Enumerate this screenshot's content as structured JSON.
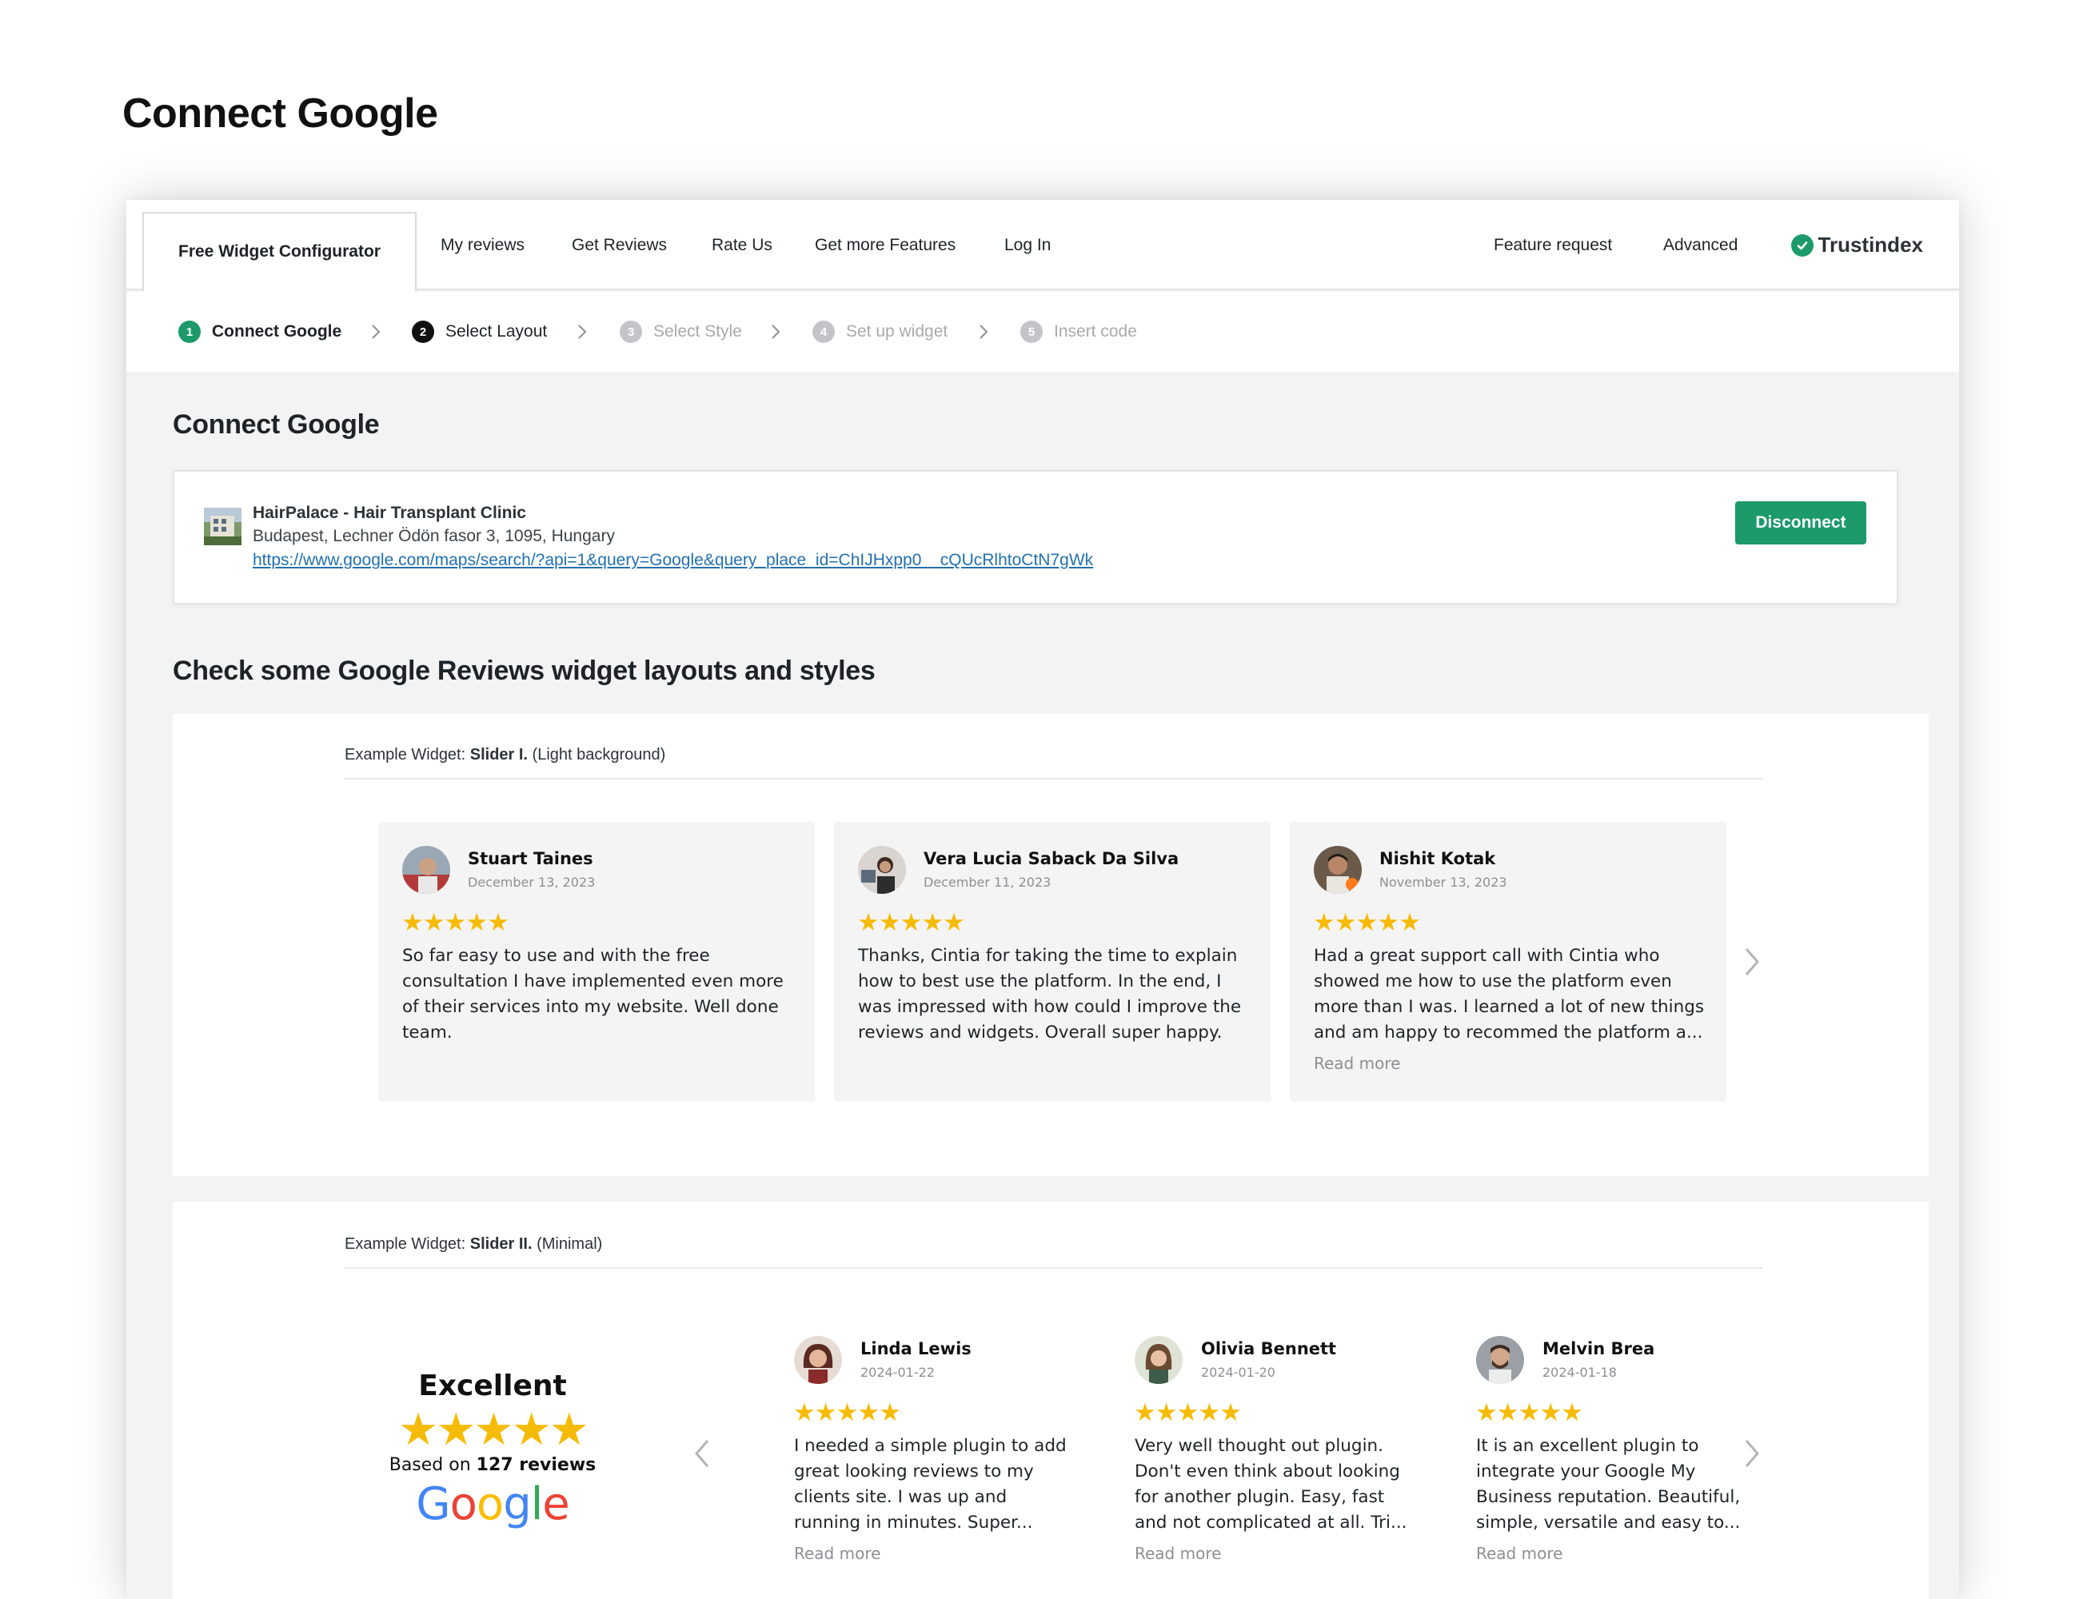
{
  "page_heading": "Connect Google",
  "nav": {
    "active_tab": "Free Widget Configurator",
    "tabs": [
      "My reviews",
      "Get Reviews",
      "Rate Us",
      "Get more Features",
      "Log In"
    ],
    "right_links": [
      "Feature request",
      "Advanced"
    ],
    "brand": "Trustindex"
  },
  "steps": [
    {
      "num": "1",
      "label": "Connect Google",
      "state": "done"
    },
    {
      "num": "2",
      "label": "Select Layout",
      "state": "current"
    },
    {
      "num": "3",
      "label": "Select Style",
      "state": "pending"
    },
    {
      "num": "4",
      "label": "Set up widget",
      "state": "pending"
    },
    {
      "num": "5",
      "label": "Insert code",
      "state": "pending"
    }
  ],
  "connect_section": {
    "title": "Connect Google",
    "place_name": "HairPalace - Hair Transplant Clinic",
    "place_address": "Budapest, Lechner Ödön fasor 3, 1095, Hungary",
    "place_link": "https://www.google.com/maps/search/?api=1&query=Google&query_place_id=ChIJHxpp0__cQUcRlhtoCtN7gWk",
    "disconnect_label": "Disconnect"
  },
  "examples_title": "Check some Google Reviews widget layouts and styles",
  "widget1": {
    "prefix": "Example Widget: ",
    "name": "Slider I.",
    "suffix": " (Light background)",
    "reviews": [
      {
        "name": "Stuart Taines",
        "date": "December 13, 2023",
        "stars": "★★★★★",
        "text": "So far easy to use and with the free consultation I have implemented even more of their services into my website. Well done team."
      },
      {
        "name": "Vera Lucia Saback Da Silva",
        "date": "December 11, 2023",
        "stars": "★★★★★",
        "text": "Thanks, Cintia for taking the time to explain how to best use the platform. In the end, I was impressed with how could I improve the reviews and widgets. Overall super happy."
      },
      {
        "name": "Nishit Kotak",
        "date": "November 13, 2023",
        "stars": "★★★★★",
        "text": "Had a great support call with Cintia who showed me how to use the platform even more than I was. I learned a lot of new things and am happy to recommed the platform a...",
        "read_more": "Read more"
      }
    ]
  },
  "widget2": {
    "prefix": "Example Widget: ",
    "name": "Slider II.",
    "suffix": " (Minimal)",
    "summary": {
      "title": "Excellent",
      "stars": "★★★★★",
      "based_on": "Based on ",
      "count": "127 reviews",
      "logo": "Google"
    },
    "reviews": [
      {
        "name": "Linda Lewis",
        "date": "2024-01-22",
        "stars": "★★★★★",
        "text": "I needed a simple plugin to add great looking reviews to my clients site. I was up and running in minutes. Super...",
        "read_more": "Read more"
      },
      {
        "name": "Olivia Bennett",
        "date": "2024-01-20",
        "stars": "★★★★★",
        "text": "Very well thought out plugin. Don't even think about looking for another plugin. Easy, fast and not complicated at all. Tri...",
        "read_more": "Read more"
      },
      {
        "name": "Melvin Brea",
        "date": "2024-01-18",
        "stars": "★★★★★",
        "text": "It is an excellent plugin to integrate your Google My Business reputation. Beautiful, simple, versatile and easy to...",
        "read_more": "Read more"
      }
    ]
  },
  "colors": {
    "accent": "#1c9a6a",
    "star": "#f6bb06",
    "link": "#2271b1"
  }
}
